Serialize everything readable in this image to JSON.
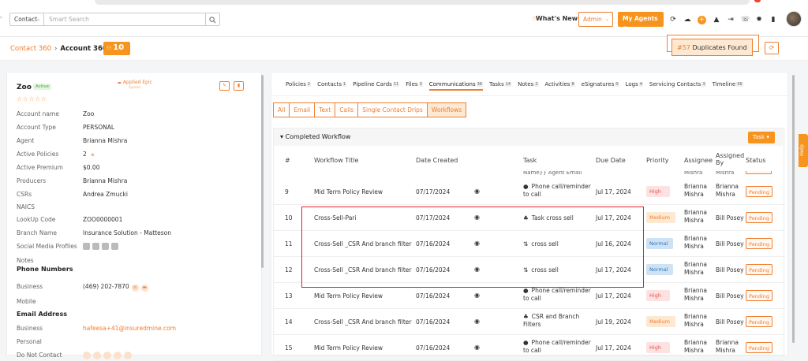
{
  "topbar": {
    "contact_select": "Contact",
    "search_placeholder": "Smart Search",
    "whats_new": "What's New",
    "admin": "Admin",
    "my_agents": "My Agents"
  },
  "crumbs": {
    "contact360": "Contact 360",
    "account360": "Account 360",
    "badge_count": "10"
  },
  "duplicates": {
    "num": "#57",
    "label": "Duplicates Found"
  },
  "account": {
    "name": "Zoo",
    "status": "Active",
    "applied_epic": "Applied Epic",
    "applied_epic_sub": "Synced",
    "stars": "☆☆☆☆☆",
    "fields": [
      {
        "label": "Account name",
        "value": "Zoo"
      },
      {
        "label": "Account Type",
        "value": "PERSONAL"
      },
      {
        "label": "Agent",
        "value": "Brianna Mishra"
      },
      {
        "label": "Active Policies",
        "value": "2"
      },
      {
        "label": "Active Premium",
        "value": "$0.00"
      },
      {
        "label": "Producers",
        "value": "Brianna Mishra"
      },
      {
        "label": "CSRs",
        "value": "Andrea Zmucki"
      },
      {
        "label": "NAICS",
        "value": ""
      },
      {
        "label": "LookUp Code",
        "value": "ZOO0000001"
      },
      {
        "label": "Branch Name",
        "value": "Insurance Solution - Matteson"
      },
      {
        "label": "Social Media Profiles",
        "value": ""
      },
      {
        "label": "Notes",
        "value": ""
      }
    ],
    "phone_section": "Phone Numbers",
    "phone_rows": [
      {
        "label": "Business",
        "value": "(469) 202-7870"
      },
      {
        "label": "Mobile",
        "value": ""
      }
    ],
    "email_section": "Email Address",
    "email_rows": [
      {
        "label": "Business",
        "value": "hafeesa+41@insuredmine.com"
      },
      {
        "label": "Personal",
        "value": ""
      },
      {
        "label": "Do Not Contact",
        "value": ""
      }
    ]
  },
  "tabs": [
    {
      "label": "Policies",
      "count": "2"
    },
    {
      "label": "Contacts",
      "count": "1"
    },
    {
      "label": "Pipeline Cards",
      "count": "11"
    },
    {
      "label": "Files",
      "count": "3"
    },
    {
      "label": "Communications",
      "count": "38",
      "active": true
    },
    {
      "label": "Tasks",
      "count": "14"
    },
    {
      "label": "Notes",
      "count": "2"
    },
    {
      "label": "Activities",
      "count": "8"
    },
    {
      "label": "eSignatures",
      "count": "0"
    },
    {
      "label": "Logs",
      "count": "4"
    },
    {
      "label": "Servicing Contacts",
      "count": "3"
    },
    {
      "label": "Timeline",
      "count": "56"
    }
  ],
  "subtabs": [
    "All",
    "Email",
    "Text",
    "Calls",
    "Single Contact Drips",
    "Workflows"
  ],
  "workflow": {
    "title": "Completed Workflow",
    "task_button": "Task",
    "headers": [
      "#",
      "Workflow Title",
      "Date Created",
      "Task",
      "Due Date",
      "Priority",
      "Assignee",
      "Assigned By",
      "Status"
    ],
    "partial_top_task": "Name}} Agent Email",
    "partial_top_assignee": "Mishra",
    "rows": [
      {
        "num": "9",
        "title": "Mid Term Policy Review",
        "created": "07/17/2024",
        "task_icon": "●",
        "task": "Phone call/reminder to call",
        "due": "Jul 17, 2024",
        "priority": "High",
        "assignee": "Brianna Mishra",
        "assigned_by": "Brianna Mishra",
        "status": "Pending"
      },
      {
        "num": "10",
        "title": "Cross-Sell-Pari",
        "created": "07/17/2024",
        "task_icon": "♣",
        "task": "Task cross sell",
        "due": "Jul 17, 2024",
        "priority": "Medium",
        "assignee": "Brianna Mishra",
        "assigned_by": "Bill Posey",
        "status": "Pending"
      },
      {
        "num": "11",
        "title": "Cross-Sell _CSR And branch filter",
        "created": "07/16/2024",
        "task_icon": "⇅",
        "task": "cross sell",
        "due": "Jul 16, 2024",
        "priority": "Normal",
        "assignee": "Brianna Mishra",
        "assigned_by": "Bill Posey",
        "status": "Pending"
      },
      {
        "num": "12",
        "title": "Cross-Sell _CSR And branch filter",
        "created": "07/16/2024",
        "task_icon": "⇅",
        "task": "cross sell",
        "due": "Jul 17, 2024",
        "priority": "Normal",
        "assignee": "Brianna Mishra",
        "assigned_by": "Bill Posey",
        "status": "Pending"
      },
      {
        "num": "13",
        "title": "Mid Term Policy Review",
        "created": "07/16/2024",
        "task_icon": "●",
        "task": "Phone call/reminder to call",
        "due": "Jul 17, 2024",
        "priority": "High",
        "assignee": "Brianna Mishra",
        "assigned_by": "Bill Posey",
        "status": "Pending"
      },
      {
        "num": "14",
        "title": "Cross-Sell _CSR And branch filter",
        "created": "07/16/2024",
        "task_icon": "♣",
        "task": "CSR and Branch Filters",
        "due": "Jul 19, 2024",
        "priority": "Medium",
        "assignee": "Brianna Mishra",
        "assigned_by": "Bill Posey",
        "status": "Pending"
      },
      {
        "num": "15",
        "title": "Mid Term Policy Review",
        "created": "07/16/2024",
        "task_icon": "●",
        "task": "Phone call/reminder to call",
        "due": "Jul 17, 2024",
        "priority": "High",
        "assignee": "Brianna Mishra",
        "assigned_by": "Brianna Mishra",
        "status": "Pending"
      }
    ]
  },
  "help": "Help"
}
